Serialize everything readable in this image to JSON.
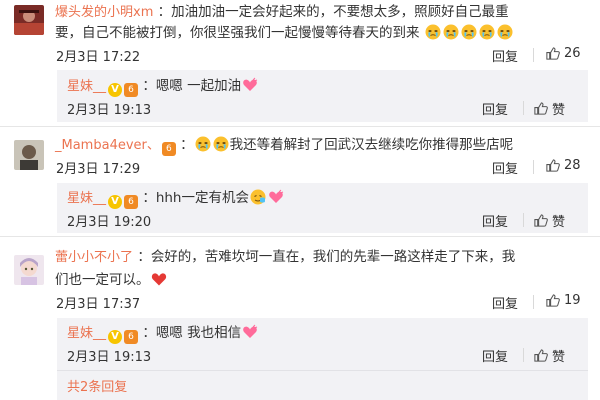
{
  "comments": [
    {
      "user": "爆头发的小明xm",
      "text_line1": "加油加油一定会好起来的，不要想太多，照顾好自己最重",
      "text_line2": "要，自己不能被打倒，你很坚强我们一起慢慢等待春天的到来",
      "time": "2月3日 17:22",
      "reply_label": "回复",
      "like_count": "26",
      "reply": {
        "user": "星妹__",
        "text": "嗯嗯 一起加油",
        "time": "2月3日 19:13",
        "reply_label": "回复",
        "like_label": "赞"
      }
    },
    {
      "user": "_Mamba4ever、",
      "text": "我还等着解封了回武汉去继续吃你推得那些店呢",
      "time": "2月3日 17:29",
      "reply_label": "回复",
      "like_count": "28",
      "reply": {
        "user": "星妹__",
        "text": "hhh一定有机会",
        "time": "2月3日 19:20",
        "reply_label": "回复",
        "like_label": "赞"
      }
    },
    {
      "user": "蕾小小不小了",
      "text_line1": "会好的，苦难坎坷一直在，我们的先辈一路这样走了下来，我",
      "text_line2": "们也一定可以。",
      "time": "2月3日 17:37",
      "reply_label": "回复",
      "like_count": "19",
      "reply": {
        "user": "星妹__",
        "text": "嗯嗯 我也相信",
        "time": "2月3日 19:13",
        "reply_label": "回复",
        "like_label": "赞"
      },
      "more_replies": "共2条回复"
    }
  ],
  "badges": {
    "v": "V",
    "level": "6"
  },
  "colors": {
    "username": "#eb7350",
    "reply_bg": "#f2f2f5"
  }
}
